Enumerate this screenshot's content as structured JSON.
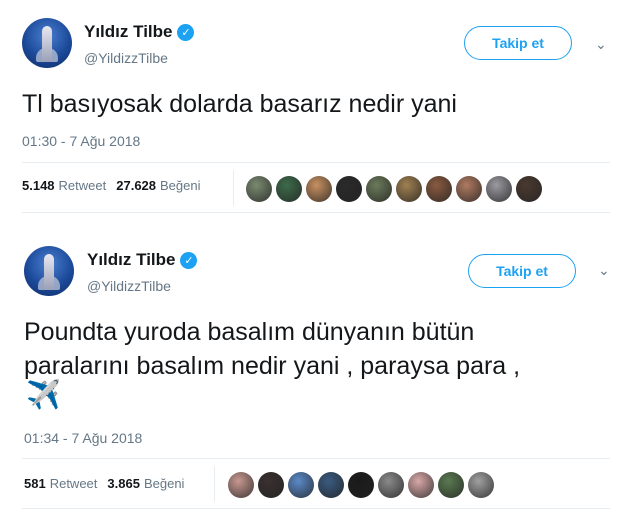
{
  "tweets": [
    {
      "name": "Yıldız Tilbe",
      "handle": "@YildizzTilbe",
      "follow_label": "Takip et",
      "text": "Tl basıyosak dolarda basarız nedir yani",
      "time": "01:30 - 7 Ağu 2018",
      "retweets": "5.148",
      "retweet_label": "Retweet",
      "likes": "27.628",
      "likes_label": "Beğeni",
      "liker_colors": [
        "#7a8a70",
        "#3d6b4a",
        "#c89060",
        "#2a2a2a",
        "#6a7a5a",
        "#a08050",
        "#8a5a40",
        "#b07a60",
        "#9a9aa0",
        "#4a3a30"
      ]
    },
    {
      "name": "Yıldız Tilbe",
      "handle": "@YildizzTilbe",
      "follow_label": "Takip et",
      "text_line1": "Poundta yuroda basalım dünyanın bütün",
      "text_line2": "paralarını basalım nedir yani , paraysa para ,",
      "emoji": "✈️",
      "time": "01:34 - 7 Ağu 2018",
      "retweets": "581",
      "retweet_label": "Retweet",
      "likes": "3.865",
      "likes_label": "Beğeni",
      "liker_colors": [
        "#c89890",
        "#3a3030",
        "#5a8ac8",
        "#3a5a80",
        "#1a1a1a",
        "#8a8a8a",
        "#d8a8a8",
        "#5a7a50",
        "#a0a0a0"
      ]
    }
  ],
  "icons": {
    "verified": "check",
    "chevron": "chevron-down-icon",
    "plane": "airplane-icon"
  },
  "colors": {
    "accent": "#1da1f2",
    "muted": "#657786"
  }
}
